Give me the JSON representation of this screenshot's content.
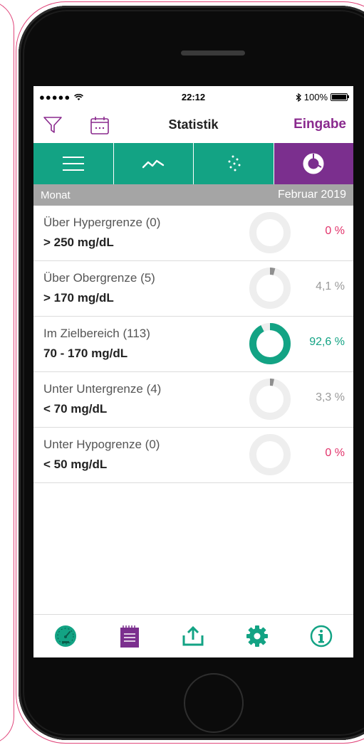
{
  "status_bar": {
    "signal": "●●●●● ",
    "time": "22:12",
    "battery": "100%"
  },
  "nav": {
    "title": "Statistik",
    "entry_label": "Eingabe"
  },
  "segments": [
    {
      "icon": "list-icon",
      "selected": false
    },
    {
      "icon": "line-chart-icon",
      "selected": false
    },
    {
      "icon": "scatter-icon",
      "selected": false
    },
    {
      "icon": "donut-chart-icon",
      "selected": true
    }
  ],
  "period": {
    "label": "Monat",
    "value": "Februar 2019"
  },
  "rows": [
    {
      "label": "Über Hypergrenze (0)",
      "range": "> 250 mg/dL",
      "percent_text": "0 %",
      "fraction": 0.0,
      "color": "#e2336b"
    },
    {
      "label": "Über Obergrenze (5)",
      "range": "> 170 mg/dL",
      "percent_text": "4,1 %",
      "fraction": 0.041,
      "color": "#9a9a9a"
    },
    {
      "label": "Im Zielbereich (113)",
      "range": "70 - 170 mg/dL",
      "percent_text": "92,6 %",
      "fraction": 0.926,
      "color": "#13a384"
    },
    {
      "label": "Unter Untergrenze (4)",
      "range": "< 70 mg/dL",
      "percent_text": "3,3 %",
      "fraction": 0.033,
      "color": "#9a9a9a"
    },
    {
      "label": "Unter Hypogrenze (0)",
      "range": "< 50 mg/dL",
      "percent_text": "0 %",
      "fraction": 0.0,
      "color": "#e2336b"
    }
  ],
  "tabs": [
    {
      "icon": "speedometer-icon"
    },
    {
      "icon": "notebook-icon"
    },
    {
      "icon": "share-upload-icon"
    },
    {
      "icon": "settings-gear-icon"
    },
    {
      "icon": "info-icon"
    }
  ],
  "colors": {
    "green": "#13a384",
    "purple": "#7b2f8e",
    "pink": "#e2336b",
    "gray_track": "#eeeeee"
  }
}
